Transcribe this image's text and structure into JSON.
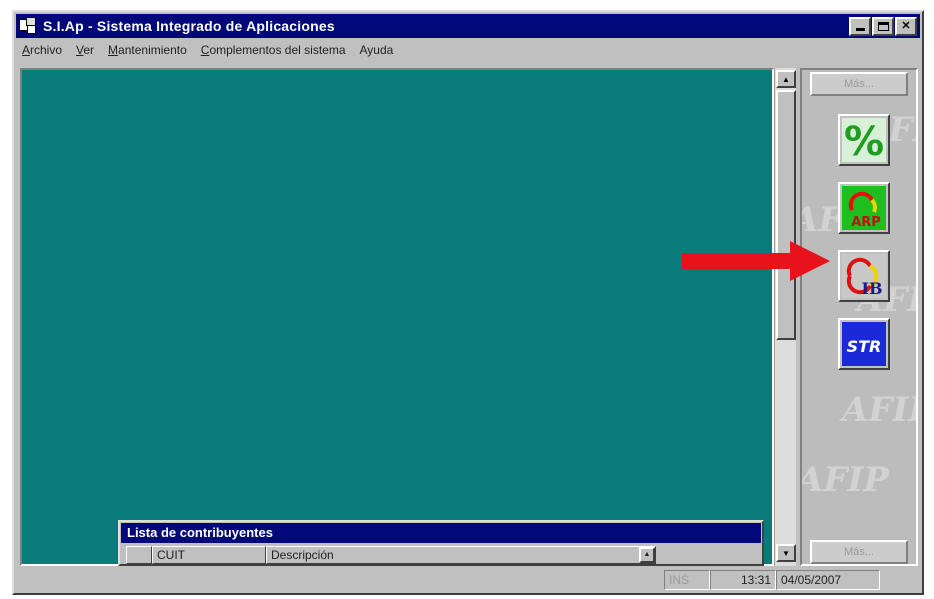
{
  "window": {
    "title": "S.I.Ap - Sistema Integrado de Aplicaciones",
    "controls": {
      "minimize": "minimize",
      "maximize": "maximize",
      "close": "✕"
    }
  },
  "menu": {
    "items": [
      {
        "label": "Archivo",
        "mnemonic": "A",
        "rest": "rchivo"
      },
      {
        "label": "Ver",
        "mnemonic": "V",
        "rest": "er"
      },
      {
        "label": "Mantenimiento",
        "mnemonic": "M",
        "rest": "antenimiento"
      },
      {
        "label": "Complementos del sistema",
        "mnemonic": "C",
        "rest": "omplementos del sistema"
      },
      {
        "label": "Ayuda",
        "mnemonic": "",
        "rest": "Ayuda"
      }
    ]
  },
  "side_panel": {
    "top_button": "Más...",
    "bottom_button": "Más...",
    "watermark": [
      "AFIP",
      "AFIP",
      "AFIP",
      "AFIP",
      "AFIP"
    ],
    "apps": [
      {
        "name": "percent-app",
        "glyph": "%",
        "color": "#22aa22"
      },
      {
        "name": "arp-app",
        "label": "ARP",
        "color": "#20b020"
      },
      {
        "name": "ib-app",
        "label": "IB",
        "color": "#c0c0c0"
      },
      {
        "name": "str-app",
        "label": "STR",
        "color": "#1a2ad8"
      }
    ]
  },
  "subwindow": {
    "title": "Lista de contribuyentes",
    "columns": [
      "CUIT",
      "Descripción"
    ]
  },
  "status": {
    "ins": "INS",
    "time": "13:31",
    "date": "04/05/2007"
  },
  "colors": {
    "titlebar": "#00087a",
    "desktop": "#0a7b7b",
    "arrow": "#e8121a"
  }
}
